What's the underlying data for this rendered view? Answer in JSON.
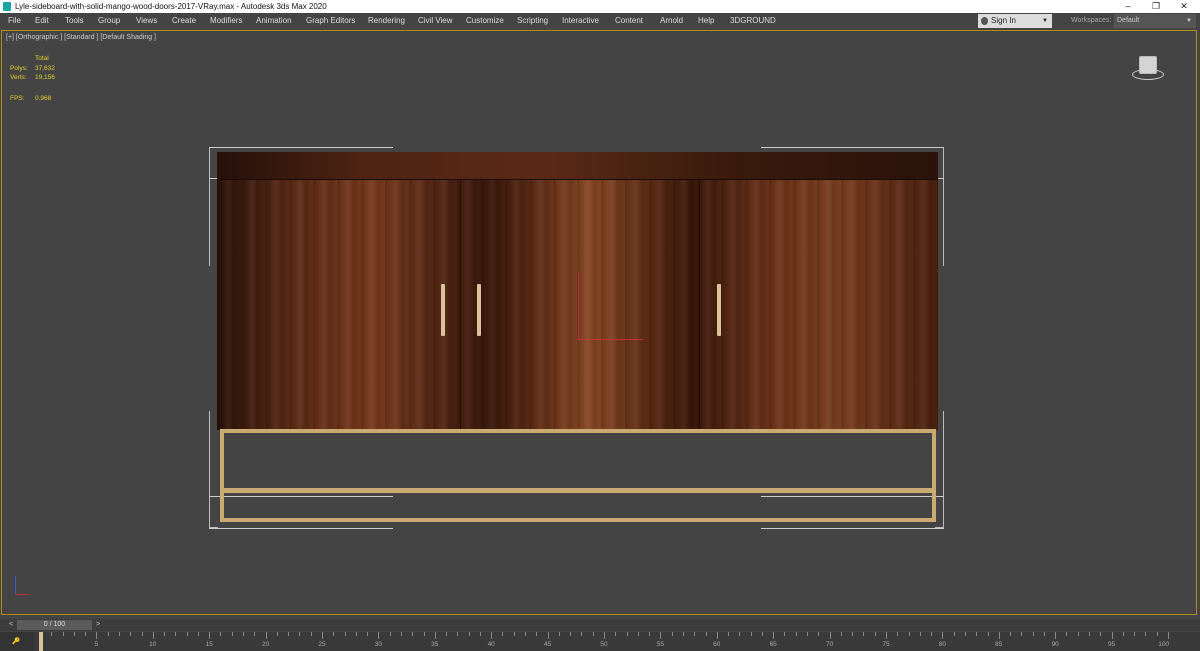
{
  "window": {
    "title": "Lyle-sideboard-with-solid-mango-wood-doors-2017-VRay.max - Autodesk 3ds Max 2020",
    "minimize": "–",
    "restore": "❐",
    "close": "✕"
  },
  "menu": [
    "File",
    "Edit",
    "Tools",
    "Group",
    "Views",
    "Create",
    "Modifiers",
    "Animation",
    "Graph Editors",
    "Rendering",
    "Civil View",
    "Customize",
    "Scripting",
    "Interactive",
    "Content",
    "Arnold",
    "Help",
    "3DGROUND"
  ],
  "signin": {
    "label": "Sign In",
    "caret": "▼"
  },
  "workspace": {
    "label": "Workspaces:",
    "value": "Default",
    "caret": "▼"
  },
  "viewport": {
    "label": "[+] [Orthographic ] [Standard ] [Default Shading ]",
    "stats": {
      "total_label": "Total",
      "polys_label": "Polys:",
      "polys_value": "37,632",
      "verts_label": "Verts:",
      "verts_value": "19,156",
      "fps_label": "FPS:",
      "fps_value": "0.968"
    }
  },
  "timeline": {
    "position": "0 / 100",
    "prev": "<",
    "next": ">",
    "corner": "🔑",
    "ticks": [
      0,
      5,
      10,
      15,
      20,
      25,
      30,
      35,
      40,
      45,
      50,
      55,
      60,
      65,
      70,
      75,
      80,
      85,
      90,
      95,
      100
    ]
  },
  "colors": {
    "accent_border": "#b28a1e",
    "stats_text": "#e6d32a",
    "frame_brass": "#c8aa72"
  }
}
